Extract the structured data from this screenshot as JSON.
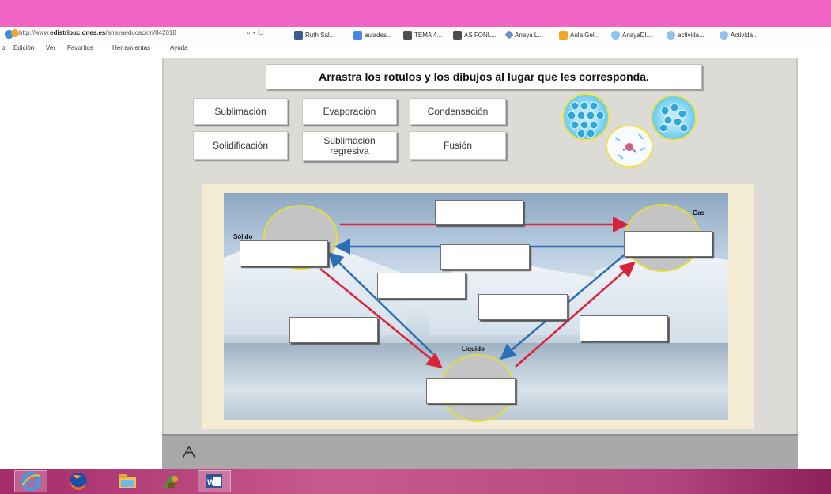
{
  "browser": {
    "url_prefix": "http://www.",
    "url_domain": "edistribuciones.es",
    "url_rest": "/anayaeducacion/842018",
    "search_glyph": "⌕ ▾ ↻",
    "favorites": [
      "Ruth Sal...",
      "aulades...",
      "TEMA 4...",
      "AS FONL...",
      "Anaya L...",
      "Aula Gel...",
      "AnayaDI...",
      "activida...",
      "Activida..."
    ],
    "menu": [
      "Edición",
      "Ver",
      "Favoritos",
      "Herramientas",
      "Ayuda"
    ],
    "menu_prefix": "o"
  },
  "activity": {
    "instruction": "Arrastra los rotulos y los dibujos al lugar que les corresponda.",
    "labels": {
      "sublimacion": "Sublimación",
      "evaporacion": "Evaporación",
      "condensacion": "Condensación",
      "solidificacion": "Solidificación",
      "sublimacion_regresiva": "Sublimación\nregresiva",
      "fusion": "Fusión"
    },
    "states": {
      "solid": "Sólido",
      "gas": "Gas",
      "liquid": "Liquido"
    }
  },
  "icons": {
    "ie": "internet-explorer-icon",
    "firefox": "firefox-icon",
    "explorer": "file-explorer-icon",
    "word": "word-icon"
  },
  "colors": {
    "browser_chrome": "#f064c3",
    "arrow_red": "#d8233a",
    "arrow_blue": "#2d6fb5",
    "circle_border": "#e5dd3a",
    "taskbar": "#b3467e"
  }
}
